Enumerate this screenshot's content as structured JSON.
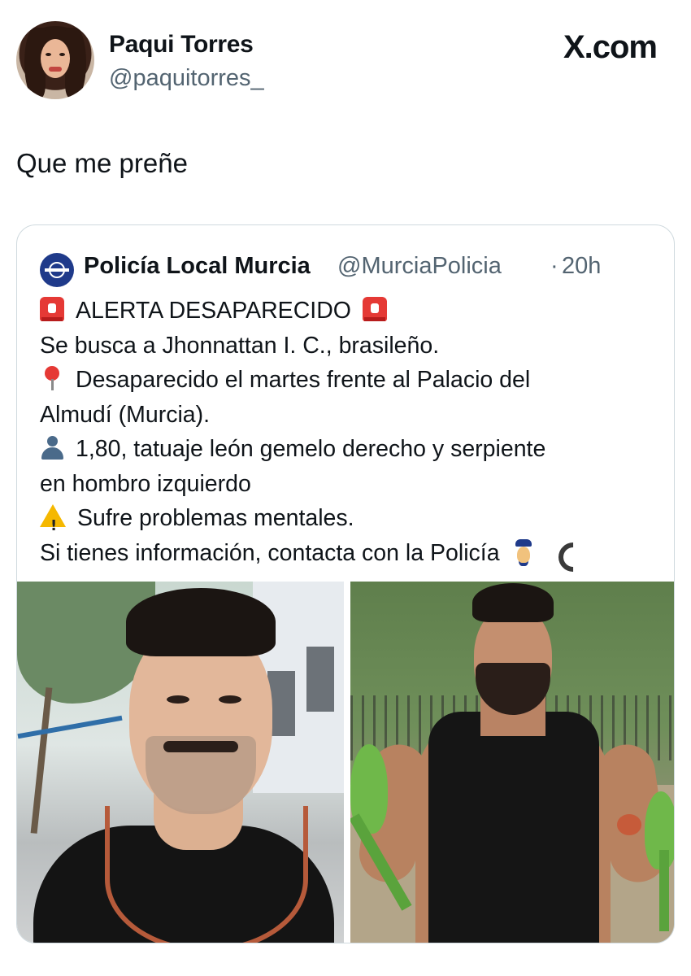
{
  "post": {
    "author_name": "Paqui Torres",
    "author_handle": "@paquitorres_",
    "site_logo": "X.com",
    "text": "Que me preñe"
  },
  "quoted_post": {
    "author_name": "Policía Local Murcia",
    "author_handle": "@MurciaPolicia",
    "separator": "·",
    "time": "20h",
    "lines": {
      "alert": "ALERTA DESAPARECIDO",
      "search": "Se busca a Jhonnattan I. C., brasileño.",
      "missing_1": "Desaparecido el martes frente al Palacio del",
      "missing_2": "Almudí (Murcia).",
      "description_1": "1,80, tatuaje león gemelo derecho y serpiente",
      "description_2": "en hombro izquierdo",
      "health": "Sufre problemas mentales.",
      "contact": "Si tienes información, contacta con la Policía"
    },
    "emoji_icons": [
      "siren-icon",
      "pushpin-icon",
      "person-silhouette-icon",
      "warning-icon",
      "police-officer-icon",
      "telephone-icon"
    ],
    "photos": [
      "missing-person-photo-selfie",
      "missing-person-photo-park-with-parrots"
    ]
  },
  "colors": {
    "text_primary": "#0f1419",
    "text_secondary": "#536471",
    "border": "#cfd9de",
    "siren_red": "#e53935",
    "warning_yellow": "#f5b800"
  }
}
